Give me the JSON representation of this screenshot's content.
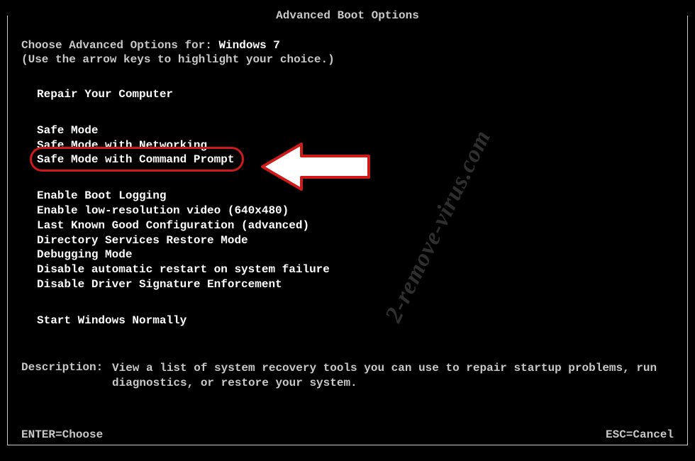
{
  "title": "Advanced Boot Options",
  "prompt": {
    "prefix": "Choose Advanced Options for: ",
    "os": "Windows 7",
    "hint": "(Use the arrow keys to highlight your choice.)"
  },
  "groups": {
    "repair": [
      "Repair Your Computer"
    ],
    "safe": [
      "Safe Mode",
      "Safe Mode with Networking",
      "Safe Mode with Command Prompt"
    ],
    "other": [
      "Enable Boot Logging",
      "Enable low-resolution video (640x480)",
      "Last Known Good Configuration (advanced)",
      "Directory Services Restore Mode",
      "Debugging Mode",
      "Disable automatic restart on system failure",
      "Disable Driver Signature Enforcement"
    ],
    "normal": [
      "Start Windows Normally"
    ]
  },
  "highlighted_index": 2,
  "description": {
    "label": "Description:",
    "text": "View a list of system recovery tools you can use to repair startup problems, run diagnostics, or restore your system."
  },
  "footer": {
    "enter": "ENTER=Choose",
    "esc": "ESC=Cancel"
  },
  "watermark": "2-remove-virus.com"
}
